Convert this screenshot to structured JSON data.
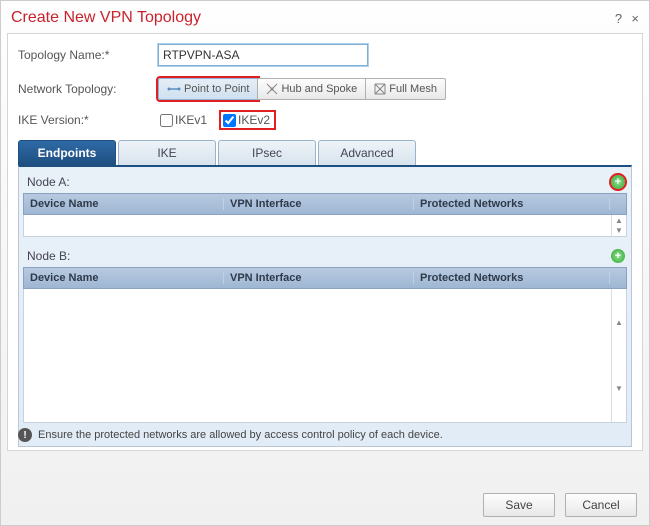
{
  "dialog": {
    "title": "Create New VPN Topology",
    "help_icon": "?",
    "close_icon": "×"
  },
  "fields": {
    "topology_name_label": "Topology Name:*",
    "topology_name_value": "RTPVPN-ASA",
    "network_topology_label": "Network Topology:",
    "topology_options": {
      "ptp": "Point to Point",
      "hub": "Hub and Spoke",
      "mesh": "Full Mesh"
    },
    "ike_label": "IKE Version:*",
    "ike_v1": "IKEv1",
    "ike_v1_checked": false,
    "ike_v2": "IKEv2",
    "ike_v2_checked": true
  },
  "tabs": {
    "endpoints": "Endpoints",
    "ike": "IKE",
    "ipsec": "IPsec",
    "advanced": "Advanced"
  },
  "nodes": {
    "a_label": "Node A:",
    "b_label": "Node B:",
    "columns": {
      "device": "Device Name",
      "iface": "VPN Interface",
      "nets": "Protected Networks"
    }
  },
  "footer": {
    "note": "Ensure the protected networks are allowed by access control policy of each device."
  },
  "actions": {
    "save": "Save",
    "cancel": "Cancel"
  }
}
